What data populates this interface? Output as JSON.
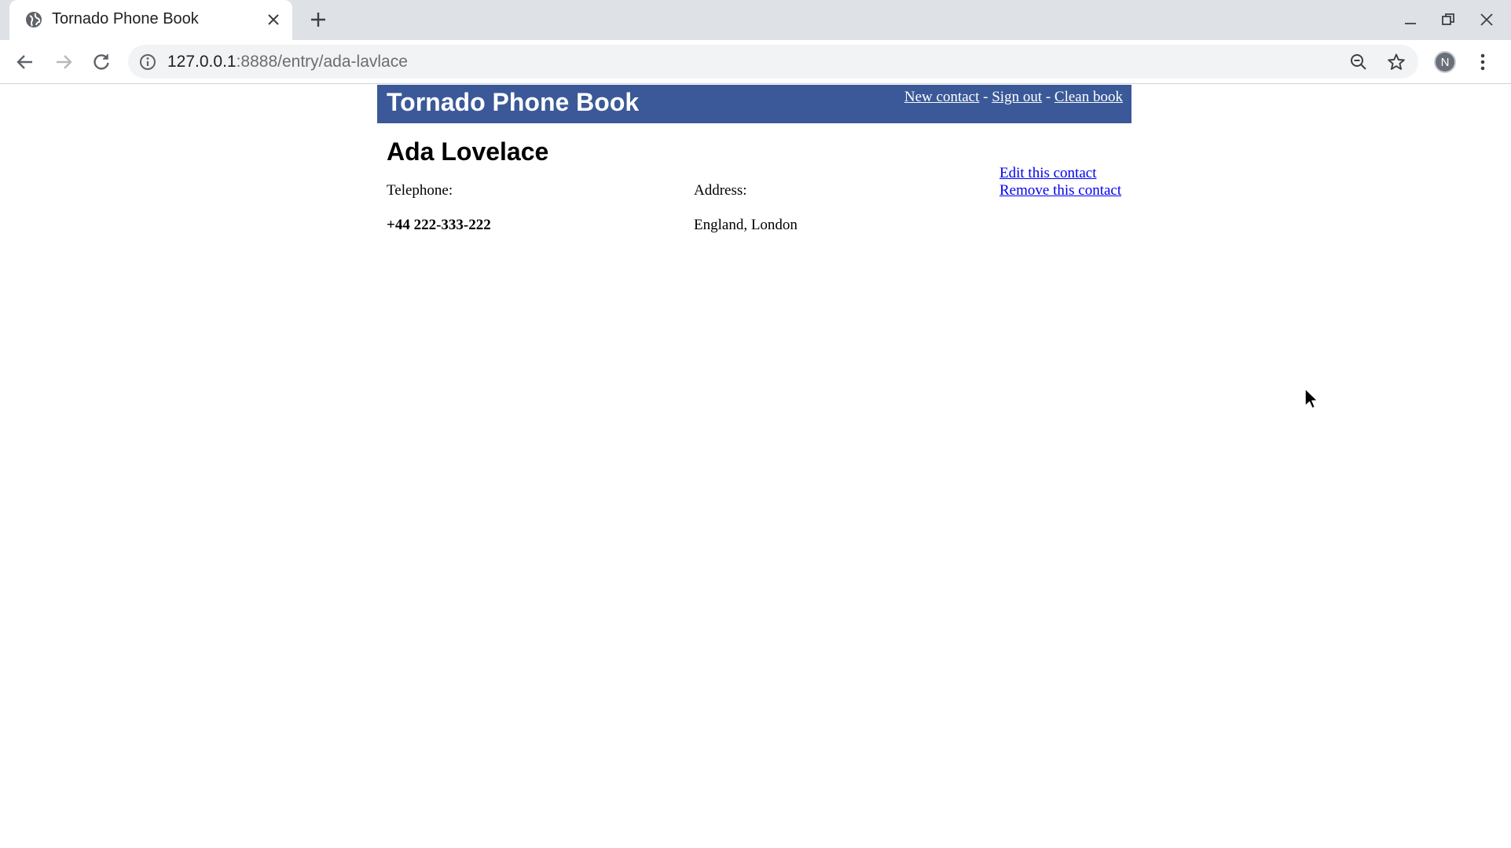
{
  "browser": {
    "tab_title": "Tornado Phone Book",
    "url_host": "127.0.0.1",
    "url_path": ":8888/entry/ada-lavlace",
    "profile_initial": "N"
  },
  "header": {
    "title": "Tornado Phone Book",
    "nav": {
      "new_contact": "New contact",
      "sign_out": "Sign out",
      "clean_book": "Clean book",
      "separator": "-"
    },
    "background_color": "#3b5998"
  },
  "contact": {
    "name": "Ada Lovelace",
    "telephone_label": "Telephone:",
    "telephone": "+44 222-333-222",
    "address_label": "Address:",
    "address": "England, London",
    "actions": {
      "edit": "Edit this contact",
      "remove": "Remove this contact"
    }
  },
  "icons": {
    "favicon": "globe-icon",
    "tab_close": "close-icon",
    "new_tab": "plus-icon",
    "back": "arrow-left-icon",
    "forward": "arrow-right-icon",
    "reload": "reload-icon",
    "site_info": "info-icon",
    "zoom": "zoom-out-icon",
    "bookmark": "star-icon",
    "menu": "kebab-menu-icon"
  }
}
